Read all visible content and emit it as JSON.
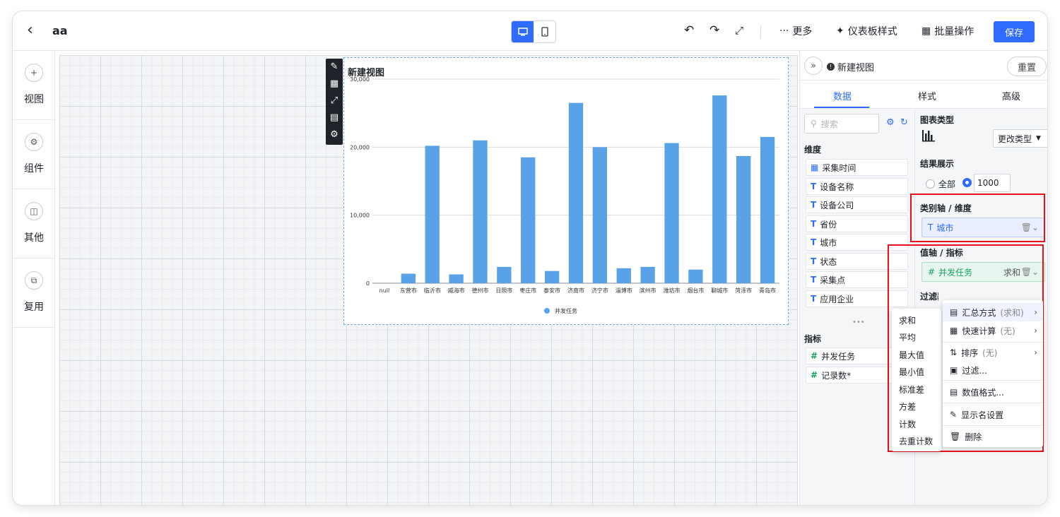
{
  "header": {
    "back_icon": "chevron-left-icon",
    "title": "aa",
    "more": "更多",
    "dashboard_style": "仪表板样式",
    "batch_ops": "批量操作",
    "save": "保存"
  },
  "rail": {
    "items": [
      {
        "label": "视图",
        "icon": "plus-circle-icon"
      },
      {
        "label": "组件",
        "icon": "gear-icon"
      },
      {
        "label": "其他",
        "icon": "cube-icon"
      },
      {
        "label": "复用",
        "icon": "copy-icon"
      }
    ]
  },
  "chart": {
    "title": "新建视图",
    "legend": "并发任务"
  },
  "chart_data": {
    "type": "bar",
    "title": "新建视图",
    "categories": [
      "null",
      "东营市",
      "临沂市",
      "威海市",
      "德州市",
      "日照市",
      "枣庄市",
      "泰安市",
      "济南市",
      "济宁市",
      "淄博市",
      "滨州市",
      "潍坊市",
      "烟台市",
      "聊城市",
      "菏泽市",
      "青岛市"
    ],
    "series": [
      {
        "name": "并发任务",
        "values": [
          0,
          1400,
          20200,
          1300,
          21000,
          2400,
          18500,
          1800,
          26500,
          20000,
          2200,
          2400,
          20600,
          2000,
          27600,
          18700,
          21500
        ]
      }
    ],
    "yticks": [
      "0",
      "10,000",
      "20,000",
      "30,000"
    ],
    "ylim": [
      0,
      30000
    ],
    "grid": true,
    "legend_position": "bottom",
    "color": "#5aa2e8"
  },
  "panel": {
    "view_name": "新建视图",
    "reset": "重置",
    "tabs": [
      "数据",
      "样式",
      "高级"
    ],
    "search_placeholder": "搜索",
    "dim_title": "维度",
    "dims": [
      "采集时间",
      "设备名称",
      "设备公司",
      "省份",
      "城市",
      "状态",
      "采集点",
      "应用企业"
    ],
    "measure_title": "指标",
    "measures": [
      "并发任务",
      "记录数*"
    ],
    "chart_type_label": "图表类型",
    "change_type": "更改类型",
    "result_label": "结果展示",
    "result_all": "全部",
    "result_count": "1000",
    "category_axis_label": "类别轴 / 维度",
    "category_field": "城市",
    "value_axis_label": "值轴 / 指标",
    "value_field": "并发任务",
    "value_agg": "求和",
    "filter_label": "过滤器"
  },
  "agg_menu": [
    "求和",
    "平均",
    "最大值",
    "最小值",
    "标准差",
    "方差",
    "计数",
    "去重计数"
  ],
  "ctx_menu": {
    "summary": "汇总方式",
    "summary_val": "(求和)",
    "quick_calc": "快速计算",
    "quick_val": "(无)",
    "sort": "排序",
    "sort_val": "(无)",
    "filter": "过滤...",
    "num_format": "数值格式...",
    "display_name": "显示名设置",
    "delete": "删除"
  }
}
